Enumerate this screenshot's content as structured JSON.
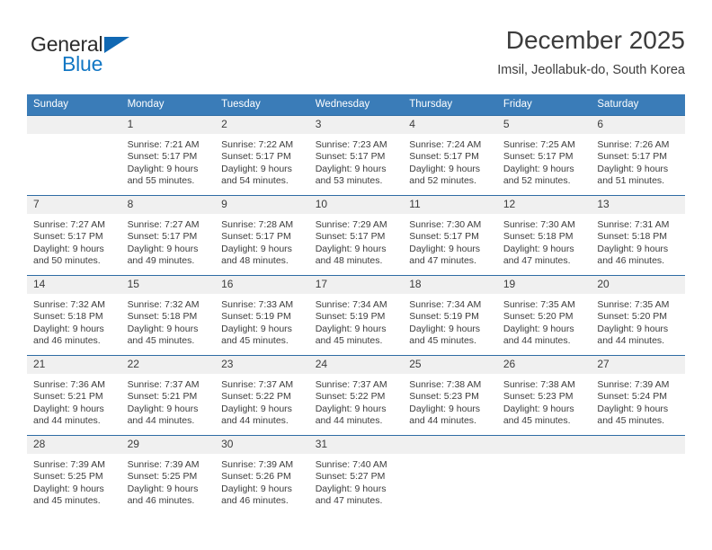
{
  "logo": {
    "text_top": "General",
    "text_bottom": "Blue",
    "accent_color": "#1068b3",
    "icon": "triangle-flag-icon"
  },
  "header": {
    "title": "December 2025",
    "location": "Imsil, Jeollabuk-do, South Korea"
  },
  "theme": {
    "header_bg": "#3a7cb8",
    "row_border": "#2e6ca4",
    "daynum_bg": "#f0f0f0",
    "text": "#3c3c3c"
  },
  "weekdays": [
    "Sunday",
    "Monday",
    "Tuesday",
    "Wednesday",
    "Thursday",
    "Friday",
    "Saturday"
  ],
  "weeks": [
    [
      {
        "day": "",
        "sunrise": "",
        "sunset": "",
        "daylight_line1": "",
        "daylight_line2": ""
      },
      {
        "day": "1",
        "sunrise": "Sunrise: 7:21 AM",
        "sunset": "Sunset: 5:17 PM",
        "daylight_line1": "Daylight: 9 hours",
        "daylight_line2": "and 55 minutes."
      },
      {
        "day": "2",
        "sunrise": "Sunrise: 7:22 AM",
        "sunset": "Sunset: 5:17 PM",
        "daylight_line1": "Daylight: 9 hours",
        "daylight_line2": "and 54 minutes."
      },
      {
        "day": "3",
        "sunrise": "Sunrise: 7:23 AM",
        "sunset": "Sunset: 5:17 PM",
        "daylight_line1": "Daylight: 9 hours",
        "daylight_line2": "and 53 minutes."
      },
      {
        "day": "4",
        "sunrise": "Sunrise: 7:24 AM",
        "sunset": "Sunset: 5:17 PM",
        "daylight_line1": "Daylight: 9 hours",
        "daylight_line2": "and 52 minutes."
      },
      {
        "day": "5",
        "sunrise": "Sunrise: 7:25 AM",
        "sunset": "Sunset: 5:17 PM",
        "daylight_line1": "Daylight: 9 hours",
        "daylight_line2": "and 52 minutes."
      },
      {
        "day": "6",
        "sunrise": "Sunrise: 7:26 AM",
        "sunset": "Sunset: 5:17 PM",
        "daylight_line1": "Daylight: 9 hours",
        "daylight_line2": "and 51 minutes."
      }
    ],
    [
      {
        "day": "7",
        "sunrise": "Sunrise: 7:27 AM",
        "sunset": "Sunset: 5:17 PM",
        "daylight_line1": "Daylight: 9 hours",
        "daylight_line2": "and 50 minutes."
      },
      {
        "day": "8",
        "sunrise": "Sunrise: 7:27 AM",
        "sunset": "Sunset: 5:17 PM",
        "daylight_line1": "Daylight: 9 hours",
        "daylight_line2": "and 49 minutes."
      },
      {
        "day": "9",
        "sunrise": "Sunrise: 7:28 AM",
        "sunset": "Sunset: 5:17 PM",
        "daylight_line1": "Daylight: 9 hours",
        "daylight_line2": "and 48 minutes."
      },
      {
        "day": "10",
        "sunrise": "Sunrise: 7:29 AM",
        "sunset": "Sunset: 5:17 PM",
        "daylight_line1": "Daylight: 9 hours",
        "daylight_line2": "and 48 minutes."
      },
      {
        "day": "11",
        "sunrise": "Sunrise: 7:30 AM",
        "sunset": "Sunset: 5:17 PM",
        "daylight_line1": "Daylight: 9 hours",
        "daylight_line2": "and 47 minutes."
      },
      {
        "day": "12",
        "sunrise": "Sunrise: 7:30 AM",
        "sunset": "Sunset: 5:18 PM",
        "daylight_line1": "Daylight: 9 hours",
        "daylight_line2": "and 47 minutes."
      },
      {
        "day": "13",
        "sunrise": "Sunrise: 7:31 AM",
        "sunset": "Sunset: 5:18 PM",
        "daylight_line1": "Daylight: 9 hours",
        "daylight_line2": "and 46 minutes."
      }
    ],
    [
      {
        "day": "14",
        "sunrise": "Sunrise: 7:32 AM",
        "sunset": "Sunset: 5:18 PM",
        "daylight_line1": "Daylight: 9 hours",
        "daylight_line2": "and 46 minutes."
      },
      {
        "day": "15",
        "sunrise": "Sunrise: 7:32 AM",
        "sunset": "Sunset: 5:18 PM",
        "daylight_line1": "Daylight: 9 hours",
        "daylight_line2": "and 45 minutes."
      },
      {
        "day": "16",
        "sunrise": "Sunrise: 7:33 AM",
        "sunset": "Sunset: 5:19 PM",
        "daylight_line1": "Daylight: 9 hours",
        "daylight_line2": "and 45 minutes."
      },
      {
        "day": "17",
        "sunrise": "Sunrise: 7:34 AM",
        "sunset": "Sunset: 5:19 PM",
        "daylight_line1": "Daylight: 9 hours",
        "daylight_line2": "and 45 minutes."
      },
      {
        "day": "18",
        "sunrise": "Sunrise: 7:34 AM",
        "sunset": "Sunset: 5:19 PM",
        "daylight_line1": "Daylight: 9 hours",
        "daylight_line2": "and 45 minutes."
      },
      {
        "day": "19",
        "sunrise": "Sunrise: 7:35 AM",
        "sunset": "Sunset: 5:20 PM",
        "daylight_line1": "Daylight: 9 hours",
        "daylight_line2": "and 44 minutes."
      },
      {
        "day": "20",
        "sunrise": "Sunrise: 7:35 AM",
        "sunset": "Sunset: 5:20 PM",
        "daylight_line1": "Daylight: 9 hours",
        "daylight_line2": "and 44 minutes."
      }
    ],
    [
      {
        "day": "21",
        "sunrise": "Sunrise: 7:36 AM",
        "sunset": "Sunset: 5:21 PM",
        "daylight_line1": "Daylight: 9 hours",
        "daylight_line2": "and 44 minutes."
      },
      {
        "day": "22",
        "sunrise": "Sunrise: 7:37 AM",
        "sunset": "Sunset: 5:21 PM",
        "daylight_line1": "Daylight: 9 hours",
        "daylight_line2": "and 44 minutes."
      },
      {
        "day": "23",
        "sunrise": "Sunrise: 7:37 AM",
        "sunset": "Sunset: 5:22 PM",
        "daylight_line1": "Daylight: 9 hours",
        "daylight_line2": "and 44 minutes."
      },
      {
        "day": "24",
        "sunrise": "Sunrise: 7:37 AM",
        "sunset": "Sunset: 5:22 PM",
        "daylight_line1": "Daylight: 9 hours",
        "daylight_line2": "and 44 minutes."
      },
      {
        "day": "25",
        "sunrise": "Sunrise: 7:38 AM",
        "sunset": "Sunset: 5:23 PM",
        "daylight_line1": "Daylight: 9 hours",
        "daylight_line2": "and 44 minutes."
      },
      {
        "day": "26",
        "sunrise": "Sunrise: 7:38 AM",
        "sunset": "Sunset: 5:23 PM",
        "daylight_line1": "Daylight: 9 hours",
        "daylight_line2": "and 45 minutes."
      },
      {
        "day": "27",
        "sunrise": "Sunrise: 7:39 AM",
        "sunset": "Sunset: 5:24 PM",
        "daylight_line1": "Daylight: 9 hours",
        "daylight_line2": "and 45 minutes."
      }
    ],
    [
      {
        "day": "28",
        "sunrise": "Sunrise: 7:39 AM",
        "sunset": "Sunset: 5:25 PM",
        "daylight_line1": "Daylight: 9 hours",
        "daylight_line2": "and 45 minutes."
      },
      {
        "day": "29",
        "sunrise": "Sunrise: 7:39 AM",
        "sunset": "Sunset: 5:25 PM",
        "daylight_line1": "Daylight: 9 hours",
        "daylight_line2": "and 46 minutes."
      },
      {
        "day": "30",
        "sunrise": "Sunrise: 7:39 AM",
        "sunset": "Sunset: 5:26 PM",
        "daylight_line1": "Daylight: 9 hours",
        "daylight_line2": "and 46 minutes."
      },
      {
        "day": "31",
        "sunrise": "Sunrise: 7:40 AM",
        "sunset": "Sunset: 5:27 PM",
        "daylight_line1": "Daylight: 9 hours",
        "daylight_line2": "and 47 minutes."
      },
      {
        "day": "",
        "sunrise": "",
        "sunset": "",
        "daylight_line1": "",
        "daylight_line2": ""
      },
      {
        "day": "",
        "sunrise": "",
        "sunset": "",
        "daylight_line1": "",
        "daylight_line2": ""
      },
      {
        "day": "",
        "sunrise": "",
        "sunset": "",
        "daylight_line1": "",
        "daylight_line2": ""
      }
    ]
  ]
}
